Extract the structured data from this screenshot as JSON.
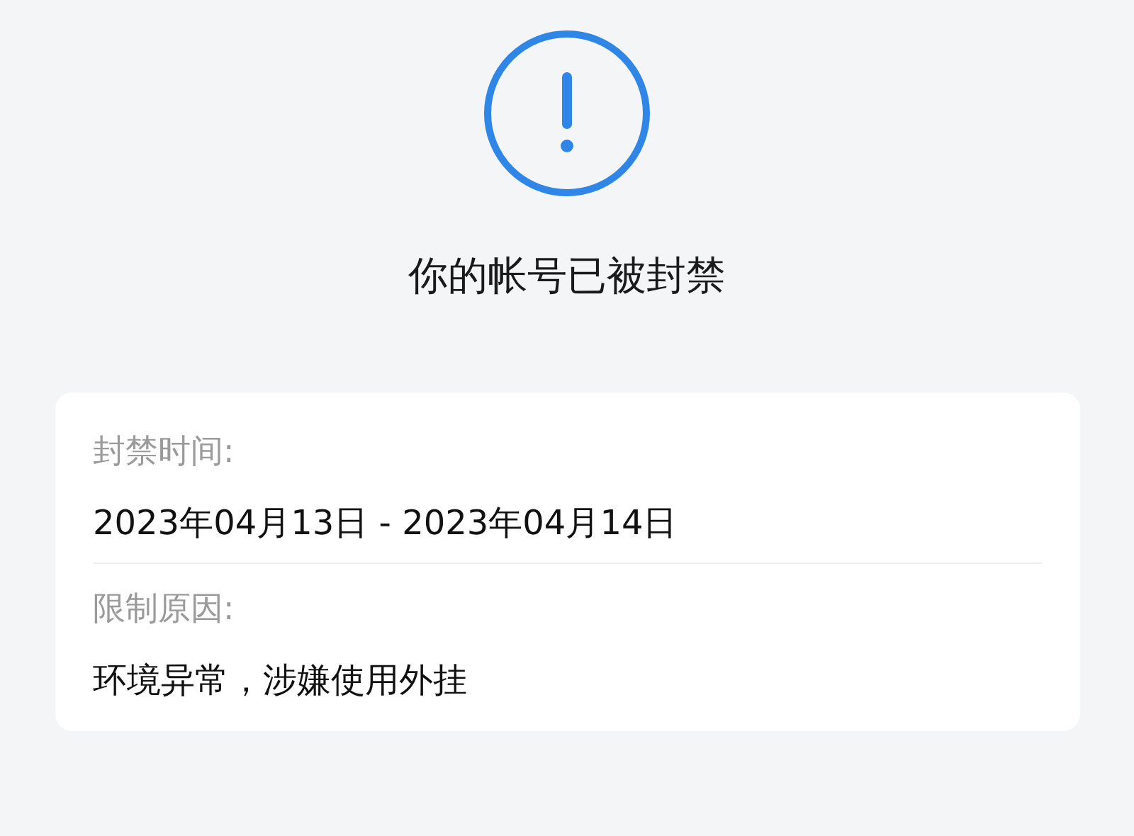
{
  "title": "你的帐号已被封禁",
  "details": [
    {
      "label": "封禁时间:",
      "value": "2023年04月13日 - 2023年04月14日"
    },
    {
      "label": "限制原因:",
      "value": "环境异常，涉嫌使用外挂"
    }
  ]
}
